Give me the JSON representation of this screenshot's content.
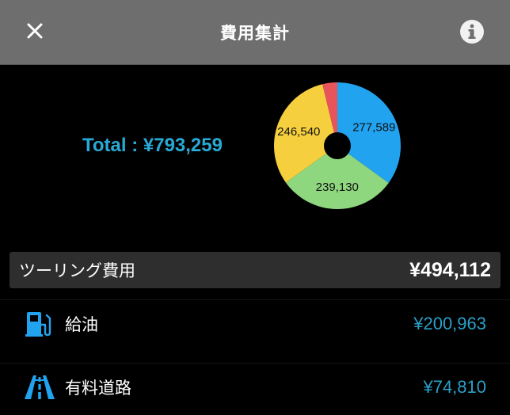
{
  "nav": {
    "title": "費用集計",
    "close_icon": "close-icon",
    "info_icon": "info-icon"
  },
  "summary": {
    "total_text": "Total : ¥793,259"
  },
  "chart_data": {
    "type": "pie",
    "style": "donut",
    "values": [
      277589,
      239130,
      246540,
      30000
    ],
    "value_labels": [
      "277,589",
      "239,130",
      "246,540",
      ""
    ],
    "colors": [
      "#21a3f0",
      "#8ed77e",
      "#f5cf3e",
      "#e8545b"
    ]
  },
  "section": {
    "label": "ツーリング費用",
    "amount": "¥494,112"
  },
  "items": [
    {
      "icon": "fuel-pump-icon",
      "name": "給油",
      "amount": "¥200,963"
    },
    {
      "icon": "toll-road-icon",
      "name": "有料道路",
      "amount": "¥74,810"
    }
  ],
  "colors": {
    "accent": "#29a9d6",
    "nav_background": "#6e6e6e",
    "section_background": "#2e2e2e"
  }
}
